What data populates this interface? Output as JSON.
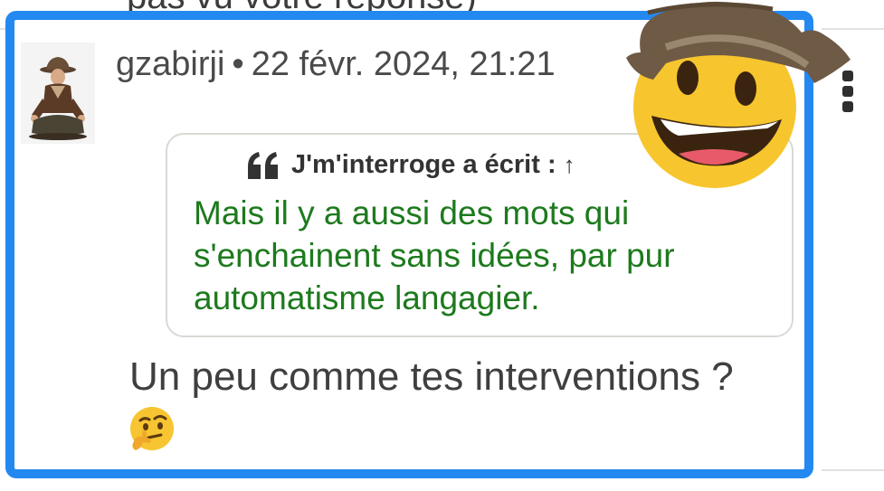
{
  "previous_post": {
    "snippet": "pas vu votre réponse)"
  },
  "post": {
    "author": "gzabirji",
    "separator": "•",
    "date": "22 févr. 2024, 21:21",
    "avatar_icon": "meditating-adventurer-avatar",
    "quote": {
      "icon": "quote-icon",
      "header": "J'm'interroge a écrit :",
      "jump_arrow": "↑",
      "text": "Mais il y a aussi des mots qui s'enchainent sans idées, par pur automatisme langagier."
    },
    "reply": "Un peu comme tes interventions ?",
    "reaction_emoji": "thinking-face-emoji",
    "menu_icon": "more-vertical-icon"
  },
  "overlay": {
    "emoji": "cowboy-hat-face-emoji"
  },
  "colors": {
    "frame_border": "#2389f0",
    "quote_text": "#1d7a1d",
    "quote_border": "#d9d9d4",
    "header_text": "#4a4a4a",
    "body_text": "#3f3f3f"
  }
}
